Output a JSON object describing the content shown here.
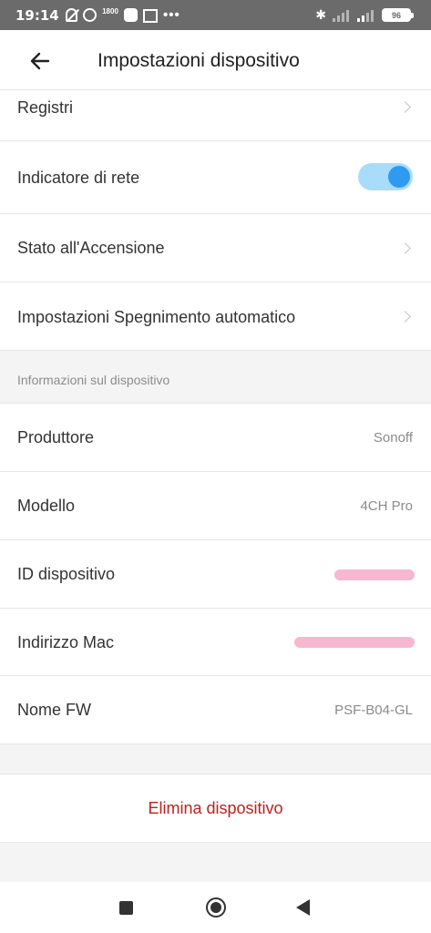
{
  "status_bar": {
    "time": "19:14",
    "network_badge": "1800",
    "more_dots": "•••",
    "bluetooth_glyph": "✱",
    "battery": "96"
  },
  "header": {
    "title": "Impostazioni dispositivo",
    "back_icon": "arrow-left-icon"
  },
  "settings": {
    "registri": "Registri",
    "indicatore_rete": "Indicatore di rete",
    "indicatore_rete_enabled": true,
    "stato_accensione": "Stato all'Accensione",
    "spegnimento_auto": "Impostazioni Spegnimento automatico"
  },
  "info_section": {
    "title": "Informazioni sul dispositivo",
    "produttore_label": "Produttore",
    "produttore_value": "Sonoff",
    "modello_label": "Modello",
    "modello_value": "4CH Pro",
    "id_label": "ID dispositivo",
    "mac_label": "Indirizzo Mac",
    "fw_label": "Nome FW",
    "fw_value": "PSF-B04-GL"
  },
  "actions": {
    "delete_label": "Elimina dispositivo"
  },
  "colors": {
    "accent": "#2e9bf0",
    "toggle_track": "#a9dcfb",
    "danger": "#c0201c",
    "redaction": "#f7b7cf"
  }
}
